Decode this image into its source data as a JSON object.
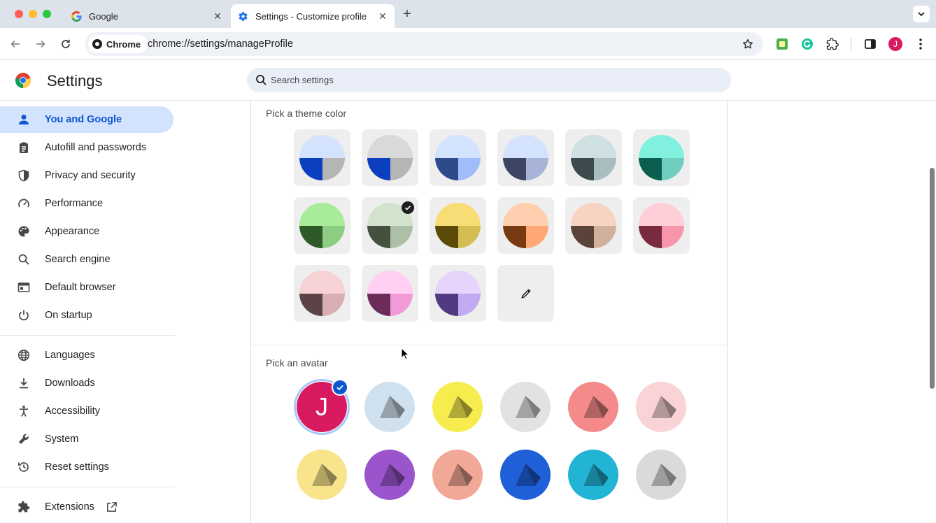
{
  "browser": {
    "tabs": [
      {
        "title": "Google",
        "favicon": "google-g-icon"
      },
      {
        "title": "Settings - Customize profile",
        "favicon": "settings-gear-icon",
        "active": true
      }
    ],
    "omnibox": {
      "chip_label": "Chrome",
      "url": "chrome://settings/manageProfile"
    },
    "profile_initial": "J",
    "accent": "#0b57d0"
  },
  "settings": {
    "title": "Settings",
    "search_placeholder": "Search settings"
  },
  "sidebar": {
    "items": [
      {
        "label": "You and Google",
        "icon": "person-icon",
        "active": true
      },
      {
        "label": "Autofill and passwords",
        "icon": "clipboard-icon"
      },
      {
        "label": "Privacy and security",
        "icon": "shield-icon"
      },
      {
        "label": "Performance",
        "icon": "speedometer-icon"
      },
      {
        "label": "Appearance",
        "icon": "palette-icon"
      },
      {
        "label": "Search engine",
        "icon": "search-icon"
      },
      {
        "label": "Default browser",
        "icon": "browser-window-icon"
      },
      {
        "label": "On startup",
        "icon": "power-icon"
      }
    ],
    "items2": [
      {
        "label": "Languages",
        "icon": "globe-icon"
      },
      {
        "label": "Downloads",
        "icon": "download-icon"
      },
      {
        "label": "Accessibility",
        "icon": "accessibility-icon"
      },
      {
        "label": "System",
        "icon": "wrench-icon"
      },
      {
        "label": "Reset settings",
        "icon": "reset-history-icon"
      }
    ],
    "extensions": {
      "label": "Extensions",
      "icon": "puzzle-icon"
    }
  },
  "theme": {
    "title": "Pick a theme color",
    "selected_index": 7,
    "colors": [
      {
        "top": "#d3e3fd",
        "bl": "#0b3fc0",
        "br": "#b5b5b5"
      },
      {
        "top": "#d9d9d9",
        "bl": "#0b3fc0",
        "br": "#b5b5b5"
      },
      {
        "top": "#d3e3fd",
        "bl": "#2d4a8a",
        "br": "#a0bdfa"
      },
      {
        "top": "#d3e3fd",
        "bl": "#3c4664",
        "br": "#a7b4d8"
      },
      {
        "top": "#cfe0e2",
        "bl": "#3d4a4d",
        "br": "#a9bcbf"
      },
      {
        "top": "#82f0df",
        "bl": "#0b5f50",
        "br": "#6fcebd"
      },
      {
        "top": "#a8ec9a",
        "bl": "#2d5a27",
        "br": "#8ecc83"
      },
      {
        "top": "#d2e3cd",
        "bl": "#46503f",
        "br": "#aebfa8"
      },
      {
        "top": "#f8dc76",
        "bl": "#5b4a08",
        "br": "#d4bd52"
      },
      {
        "top": "#ffcfb0",
        "bl": "#7a3a11",
        "br": "#ffa874"
      },
      {
        "top": "#f8d3c2",
        "bl": "#5a4439",
        "br": "#d2b09e"
      },
      {
        "top": "#ffcfd8",
        "bl": "#7a2a3e",
        "br": "#f895ab"
      },
      {
        "top": "#f6d2d4",
        "bl": "#5c4345",
        "br": "#d8aeb2"
      },
      {
        "top": "#ffd0f2",
        "bl": "#6b2c5a",
        "br": "#f29ad6"
      },
      {
        "top": "#e6d4fb",
        "bl": "#523a80",
        "br": "#c3a8f2"
      }
    ],
    "custom": {
      "icon": "eyedropper-icon"
    }
  },
  "avatar": {
    "title": "Pick an avatar",
    "selected_index": 0,
    "items": [
      {
        "name": "initial",
        "letter": "J",
        "bg": "#d81b60"
      },
      {
        "name": "cat",
        "bg": "#cfe0ee"
      },
      {
        "name": "corgi",
        "bg": "#f7ec4e"
      },
      {
        "name": "dragon",
        "bg": "#e2e2e2"
      },
      {
        "name": "elephant",
        "bg": "#f48a8a"
      },
      {
        "name": "fox",
        "bg": "#f9d3d5"
      },
      {
        "name": "monkey",
        "bg": "#f8e48a"
      },
      {
        "name": "panda",
        "bg": "#9a55cc"
      },
      {
        "name": "penguin",
        "bg": "#f2a896"
      },
      {
        "name": "bird",
        "bg": "#1f5fd8"
      },
      {
        "name": "rabbit",
        "bg": "#21b4d4"
      },
      {
        "name": "unicorn",
        "bg": "#dadada"
      }
    ]
  }
}
